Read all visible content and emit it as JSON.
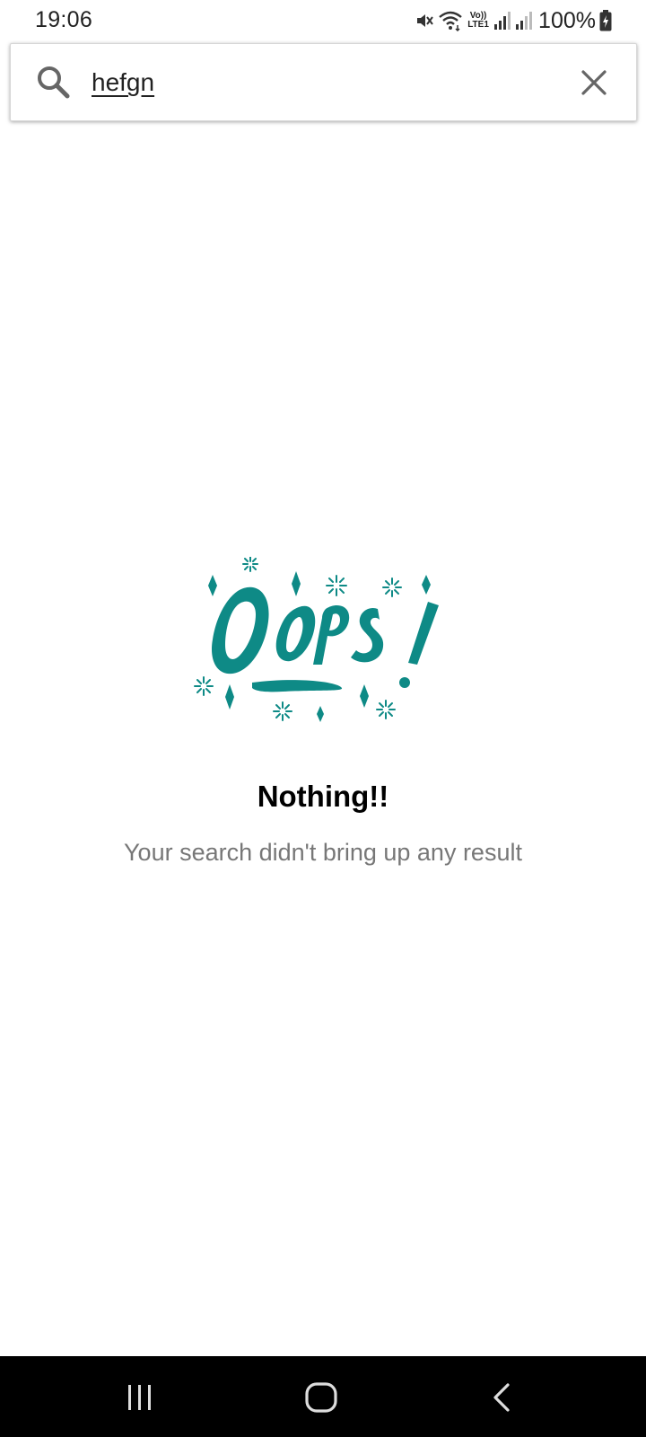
{
  "status_bar": {
    "time": "19:06",
    "volte_label": "Vo))\nLTE1",
    "battery": "100%",
    "icons": [
      "mute-icon",
      "wifi-icon",
      "volte-icon",
      "signal-icon",
      "signal-icon",
      "battery-charging-icon"
    ]
  },
  "search": {
    "query": "hefgn",
    "search_icon": "search-icon",
    "clear_icon": "close-icon"
  },
  "empty_state": {
    "graphic_text": "OOPS!",
    "title": "Nothing!!",
    "subtitle": "Your search didn't bring up any result"
  },
  "nav_bar": {
    "buttons": [
      "recent-apps",
      "home",
      "back"
    ]
  },
  "colors": {
    "accent_teal": "#0E8A86",
    "subtitle_gray": "#777777",
    "icon_gray": "#666666",
    "nav_background": "#000000"
  }
}
